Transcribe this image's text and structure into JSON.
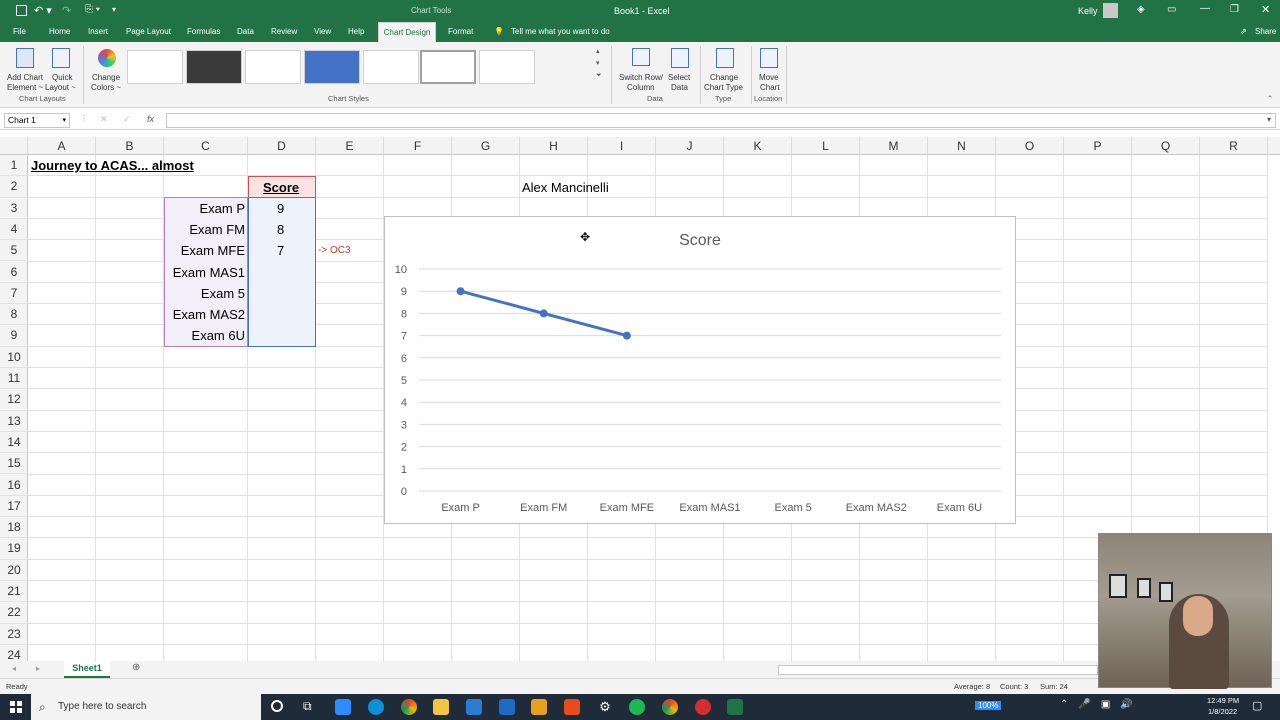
{
  "titlebar": {
    "context_tab": "Chart Tools",
    "title": "Book1 - Excel",
    "user": "Kelly"
  },
  "menu": {
    "items": [
      "File",
      "Home",
      "Insert",
      "Page Layout",
      "Formulas",
      "Data",
      "Review",
      "View",
      "Help",
      "Chart Design",
      "Format"
    ],
    "tell_me": "Tell me what you want to do",
    "share": "Share"
  },
  "ribbon": {
    "add_chart_element": [
      "Add Chart",
      "Element ~"
    ],
    "quick_layout": [
      "Quick",
      "Layout ~"
    ],
    "change_colors": [
      "Change",
      "Colors ~"
    ],
    "switch_row_col": [
      "Switch Row/",
      "Column"
    ],
    "select_data": [
      "Select",
      "Data"
    ],
    "change_chart_type": [
      "Change",
      "Chart Type"
    ],
    "move_chart": [
      "Move",
      "Chart"
    ],
    "groups": {
      "chart_layouts": "Chart Layouts",
      "chart_styles": "Chart Styles",
      "data": "Data",
      "type": "Type",
      "location": "Location"
    }
  },
  "formula_bar": {
    "name_box": "Chart 1",
    "fx": "fx",
    "formula": ""
  },
  "columns": [
    "A",
    "B",
    "C",
    "D",
    "E",
    "F",
    "G",
    "H",
    "I",
    "J",
    "K",
    "L",
    "M",
    "N",
    "O",
    "P",
    "Q",
    "R"
  ],
  "rows": [
    "1",
    "2",
    "3",
    "4",
    "5",
    "6",
    "7",
    "8",
    "9",
    "10",
    "11",
    "12",
    "13",
    "14",
    "15",
    "16",
    "17",
    "18",
    "19",
    "20",
    "21",
    "22",
    "23",
    "24"
  ],
  "sheet": {
    "a1": "Journey to ACAS... almost",
    "score_header": "Score",
    "exams": [
      "Exam P",
      "Exam FM",
      "Exam MFE",
      "Exam MAS1",
      "Exam 5",
      "Exam MAS2",
      "Exam 6U"
    ],
    "scores": [
      "9",
      "8",
      "7",
      "",
      "",
      "",
      ""
    ],
    "e5_note": "-> OC3",
    "author": "Alex Mancinelli"
  },
  "chart_data": {
    "type": "line",
    "title": "Score",
    "categories": [
      "Exam P",
      "Exam FM",
      "Exam MFE",
      "Exam MAS1",
      "Exam 5",
      "Exam MAS2",
      "Exam 6U"
    ],
    "values": [
      9,
      8,
      7,
      null,
      null,
      null,
      null
    ],
    "ylim": [
      0,
      10
    ],
    "yticks": [
      "0",
      "1",
      "2",
      "3",
      "4",
      "5",
      "6",
      "7",
      "8",
      "9",
      "10"
    ],
    "grid": true,
    "line_color": "#4472c4"
  },
  "tabs": {
    "sheet": "Sheet1"
  },
  "status": {
    "ready": "Ready",
    "average": "Average: 8",
    "count": "Count: 3",
    "sum": "Sum: 24",
    "zoom": "100%"
  },
  "taskbar": {
    "search_placeholder": "Type here to search",
    "time": "12:49 PM",
    "date": "1/8/2022"
  },
  "colors": {
    "accent": "#217346",
    "taskbar": "#1f2b38"
  }
}
